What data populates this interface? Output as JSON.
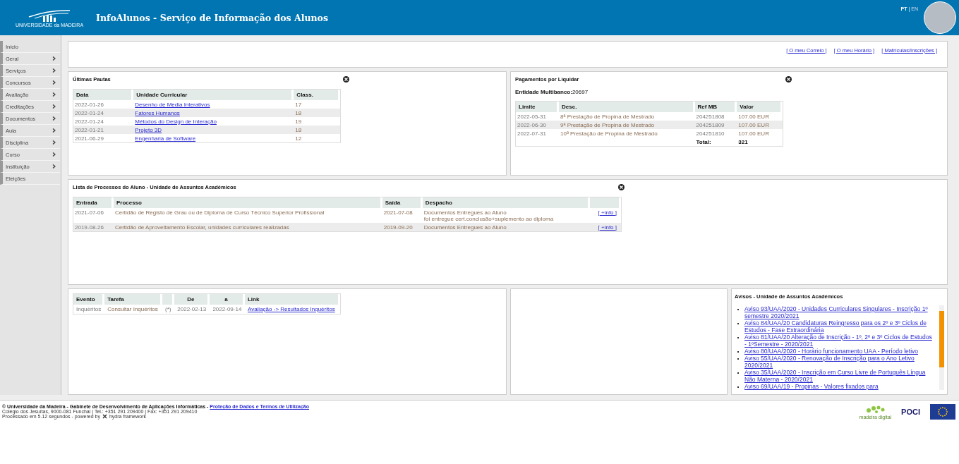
{
  "header": {
    "logo_text": "UNIVERSIDADE da MADEIRA",
    "title": "InfoAlunos - Serviço de Informação dos Alunos",
    "languages": [
      {
        "label": "PT",
        "selected": true
      },
      {
        "label": "EN",
        "selected": false
      }
    ],
    "language_separator": "|"
  },
  "sidebar": {
    "items": [
      {
        "label": "Início",
        "has_submenu": false
      },
      {
        "label": "Geral",
        "has_submenu": true
      },
      {
        "label": "Serviços",
        "has_submenu": true
      },
      {
        "label": "Concursos",
        "has_submenu": true
      },
      {
        "label": "Avaliação",
        "has_submenu": true
      },
      {
        "label": "Creditações",
        "has_submenu": true
      },
      {
        "label": "Documentos",
        "has_submenu": true
      },
      {
        "label": "Aula",
        "has_submenu": true
      },
      {
        "label": "Disciplina",
        "has_submenu": true
      },
      {
        "label": "Curso",
        "has_submenu": true
      },
      {
        "label": "Instituição",
        "has_submenu": true
      },
      {
        "label": "Eleições",
        "has_submenu": false
      }
    ]
  },
  "quick_links": [
    "[ O meu Correio ]",
    "[ O meu Horário ]",
    "[ Matrículas/Inscrições ]"
  ],
  "pautas": {
    "title": "Últimas Pautas",
    "columns": [
      {
        "label": "Data",
        "kind": "date"
      },
      {
        "label": "Unidade Curricular",
        "kind": "link"
      },
      {
        "label": "Class.",
        "kind": "text"
      }
    ],
    "rows": [
      [
        "2022-01-26",
        "Desenho de Media Interativos",
        "17"
      ],
      [
        "2022-01-24",
        "Fatores Humanos",
        "18"
      ],
      [
        "2022-01-24",
        "Métodos do Design de Interação",
        "19"
      ],
      [
        "2022-01-21",
        "Projeto 3D",
        "18"
      ],
      [
        "2021-06-29",
        "Engenharia de Software",
        "12"
      ]
    ]
  },
  "pagamentos": {
    "title": "Pagamentos por Liquidar",
    "entity_label": "Entidade Multibanco:",
    "entity_value": "20697",
    "columns": [
      {
        "label": "Limite",
        "kind": "date"
      },
      {
        "label": "Desc.",
        "kind": "text"
      },
      {
        "label": "Ref MB",
        "kind": "date"
      },
      {
        "label": "Valor",
        "kind": "text"
      }
    ],
    "rows": [
      [
        "2022-05-31",
        "8ª Prestação de Propina de Mestrado",
        "204251808",
        "107.00 EUR"
      ],
      [
        "2022-06-30",
        "9ª Prestação de Propina de Mestrado",
        "204251809",
        "107.00 EUR"
      ],
      [
        "2022-07-31",
        "10ª Prestação de Propina de Mestrado",
        "204251810",
        "107.00 EUR"
      ]
    ],
    "total_label": "Total:",
    "total_value": "321"
  },
  "processos": {
    "title": "Lista de Processos do Aluno - Unidade de Assuntos Académicos",
    "columns": [
      {
        "label": "Entrada",
        "kind": "date"
      },
      {
        "label": "Processo",
        "kind": "text"
      },
      {
        "label": "Saída",
        "kind": "text"
      },
      {
        "label": "Despacho",
        "kind": "text"
      },
      {
        "kind": "link"
      }
    ],
    "rows": [
      [
        "2021-07-06",
        "Certidão de Registo de Grau ou de Diploma de Curso Técnico Superior Profissional",
        "2021-07-08",
        "Documentos Entregues ao Aluno\nfoi entregue cert.conclusão+suplemento ao diploma",
        "[ +info ]"
      ],
      [
        "2019-08-26",
        "Certidão de Aproveitamento Escolar, unidades curriculares realizadas",
        "2019-09-20",
        "Documentos Entregues ao Aluno",
        "[ +info ]"
      ]
    ]
  },
  "inqueritos": {
    "columns": [
      {
        "label": "Evento",
        "kind": "date"
      },
      {
        "label": "Tarefa",
        "kind": "text"
      },
      {
        "kind": "center"
      },
      {
        "label": "De",
        "kind": "center"
      },
      {
        "label": "a",
        "kind": "center"
      },
      {
        "label": "Link",
        "kind": "link"
      }
    ],
    "rows": [
      [
        "Inquéritos",
        "Consultar Inquéritos",
        "(*)",
        "2022-02-13",
        "2022-09-14",
        "Avaliação -> Resultados Inquéritos"
      ]
    ]
  },
  "avisos": {
    "title": "Avisos - Unidade de Assuntos Académicos",
    "items": [
      "Aviso 93/UAA/2020 - Unidades Curriculares Singulares - Inscrição 1º semestre 2020/2021",
      "Aviso 84/UAA/20 Candidaturas Reingresso para os 2º e 3º Ciclos de Estudos - Fase Extraordinária",
      "Aviso 81/UAA/20 Alteração de Inscrição - 1º, 2º e 3º Ciclos de Estudos - 1ºSemestre - 2020/2021",
      "Aviso 80/UAA/2020 - Horário funcionamento UAA - Período letivo",
      "Aviso 55/UAA/2020 - Renovação de Inscrição para o Ano Letivo 2020/2021",
      "Aviso 35/UAA/2020 - Inscrição em Curso Livre de Português Língua Não Materna - 2020/2021",
      "Aviso 69/UAA/19 - Propinas - Valores fixados para"
    ]
  },
  "footer": {
    "copyright": "© Universidade da Madeira - Gabinete de Desenvolvimento de Aplicações Informáticas -",
    "privacy_link": "Proteção de Dados e Termos de Utilização",
    "address": "Colégio dos Jesuítas, 9000-081 Funchal | Tel.: +351 291 209400 | Fax: +351 291 209410",
    "processed": "Processado em 5.12 segundos - powered by",
    "framework": "hydra framework",
    "logos": [
      "madeira digital",
      "POCI"
    ]
  }
}
